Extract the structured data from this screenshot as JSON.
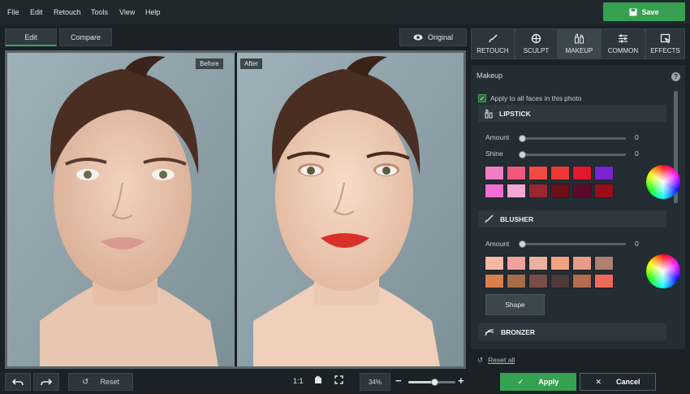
{
  "menu": [
    "File",
    "Edit",
    "Retouch",
    "Tools",
    "View",
    "Help"
  ],
  "save_label": "Save",
  "view_tabs": {
    "edit": "Edit",
    "compare": "Compare"
  },
  "original_label": "Original",
  "photo_labels": {
    "before": "Before",
    "after": "After"
  },
  "bottom": {
    "reset": "Reset",
    "one_to_one": "1:1",
    "zoom": "34%",
    "zoom_level": 0.55
  },
  "apply_label": "Apply",
  "cancel_label": "Cancel",
  "panel_tabs": [
    {
      "label": "RETOUCH",
      "icon": "brush-icon"
    },
    {
      "label": "SCULPT",
      "icon": "crosshair-icon"
    },
    {
      "label": "MAKEUP",
      "icon": "makeup-icon"
    },
    {
      "label": "COMMON",
      "icon": "sliders-icon"
    },
    {
      "label": "EFFECTS",
      "icon": "effects-icon"
    }
  ],
  "panel": {
    "title": "Makeup",
    "apply_all": "Apply to all faces in this photo",
    "lipstick": {
      "title": "LIPSTICK",
      "amount_label": "Amount",
      "amount_value": "0",
      "shine_label": "Shine",
      "shine_value": "0",
      "swatches": [
        "#f07cc3",
        "#f05a7a",
        "#f24a42",
        "#ea3a33",
        "#e3182b",
        "#7b24d1",
        "#f26ed4",
        "#f3a7d1",
        "#9c2630",
        "#6b1015",
        "#5a0a2a",
        "#9a0c18"
      ]
    },
    "blusher": {
      "title": "BLUSHER",
      "amount_label": "Amount",
      "amount_value": "0",
      "swatches": [
        "#f7b9a0",
        "#f2a09a",
        "#eab0a0",
        "#f0a282",
        "#e69c88",
        "#b08070",
        "#d9804c",
        "#a86c4c",
        "#7a4d48",
        "#4e3a3a",
        "#b66b4c",
        "#f06a5a"
      ],
      "shape_label": "Shape"
    },
    "bronzer": {
      "title": "BRONZER"
    }
  },
  "reset_all": "Reset all"
}
